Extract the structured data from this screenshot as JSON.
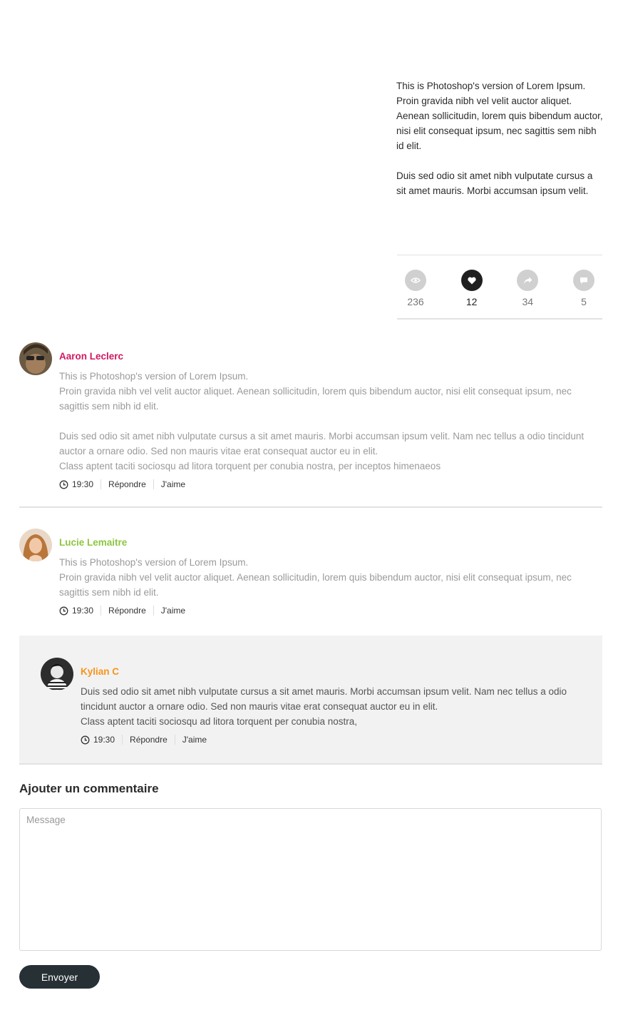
{
  "intro": {
    "paragraphs": [
      "This is Photoshop's version  of Lorem Ipsum. Proin gravida nibh vel velit auctor aliquet. Aenean sollicitudin, lorem quis bibendum auctor, nisi elit consequat ipsum, nec sagittis sem nibh id elit.",
      "Duis sed odio sit amet nibh vulputate cursus a sit amet mauris. Morbi accumsan ipsum velit."
    ]
  },
  "stats": {
    "views": {
      "count": "236",
      "icon": "eye-icon"
    },
    "likes": {
      "count": "12",
      "icon": "heart-icon"
    },
    "shares": {
      "count": "34",
      "icon": "share-icon"
    },
    "comments": {
      "count": "5",
      "icon": "comment-icon"
    }
  },
  "colors": {
    "aaron": "#d2185f",
    "lucie": "#8cc63f",
    "kylian": "#f7941d",
    "button": "#263035"
  },
  "comments": [
    {
      "author": "Aaron Leclerc",
      "lines1": [
        "This is Photoshop's version  of Lorem Ipsum.",
        "Proin gravida nibh vel velit auctor aliquet. Aenean sollicitudin, lorem quis bibendum auctor, nisi elit consequat ipsum, nec sagittis sem nibh id elit."
      ],
      "lines2": [
        "Duis sed odio sit amet nibh vulputate cursus a sit amet mauris. Morbi accumsan ipsum velit. Nam nec tellus a odio tincidunt auctor a ornare odio. Sed non  mauris vitae erat consequat auctor eu in elit.",
        "Class aptent taciti sociosqu ad litora torquent per conubia nostra, per inceptos himenaeos"
      ],
      "time": "19:30",
      "reply": "Répondre",
      "like": "J'aime"
    },
    {
      "author": "Lucie Lemaitre",
      "lines1": [
        "This is Photoshop's version  of Lorem Ipsum.",
        "Proin gravida nibh vel velit auctor aliquet. Aenean sollicitudin, lorem quis bibendum auctor, nisi elit consequat ipsum, nec sagittis sem nibh id elit."
      ],
      "time": "19:30",
      "reply": "Répondre",
      "like": "J'aime"
    },
    {
      "author": "Kylian C",
      "lines1": [
        "Duis sed odio sit amet nibh vulputate cursus a sit amet mauris. Morbi accumsan ipsum velit. Nam nec tellus a odio tincidunt auctor a ornare odio. Sed non  mauris vitae erat consequat auctor eu in elit.",
        "Class aptent taciti sociosqu ad litora torquent per conubia nostra,"
      ],
      "time": "19:30",
      "reply": "Répondre",
      "like": "J'aime"
    }
  ],
  "form": {
    "title": "Ajouter un commentaire",
    "placeholder": "Message",
    "submit": "Envoyer"
  }
}
